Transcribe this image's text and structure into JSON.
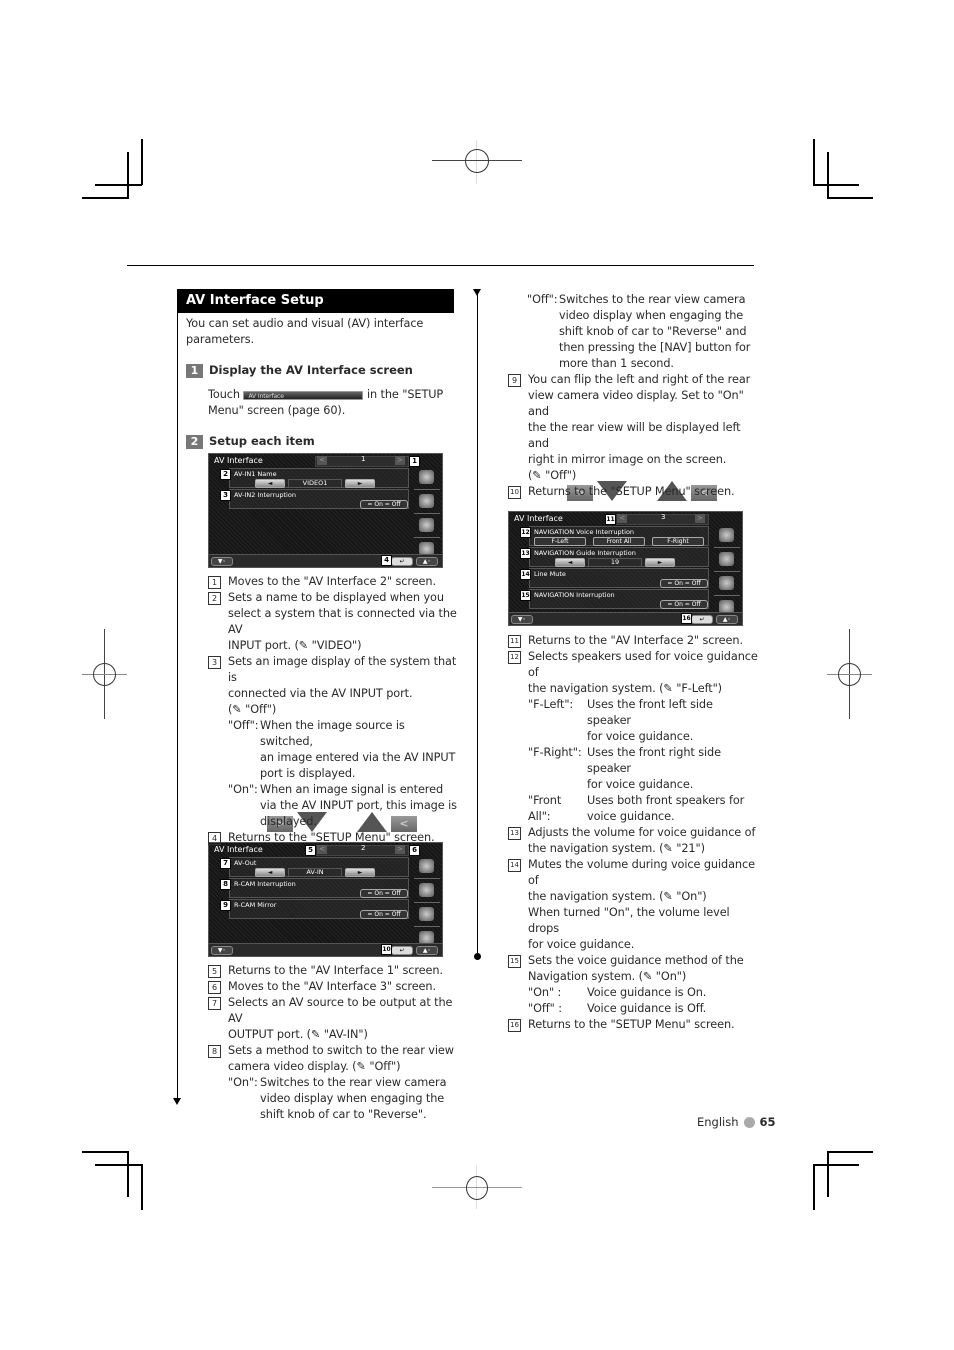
{
  "section": {
    "title": "AV Interface Setup",
    "intro": "You can set audio and visual (AV) interface parameters.",
    "intro_lines": [
      "You can set audio and visual (AV) interface",
      "parameters."
    ]
  },
  "steps": [
    {
      "num": "1",
      "label": "Display the AV Interface screen"
    },
    {
      "num": "2",
      "label": "Setup each item"
    }
  ],
  "step1_text": {
    "touch": "Touch",
    "button_label": "AV Interface",
    "rest_line1": "in the \"SETUP",
    "rest_line2": "Menu\" screen (page 60)."
  },
  "icons": {
    "wrench": "✎",
    "next": ">",
    "prev": "<",
    "return": "↵"
  },
  "screens": [
    {
      "title": "AV Interface",
      "page": "1",
      "prev_arrow": "<",
      "next_arrow": ">",
      "items": [
        {
          "badge": "2",
          "label": "AV-IN1 Name",
          "type": "selector",
          "value": "VIDEO1",
          "left": "◄",
          "right": "►"
        },
        {
          "badge": "3",
          "label": "AV-IN2 Interruption",
          "type": "onoff",
          "on": "On",
          "off": "Off"
        }
      ],
      "badges": {
        "next": "1",
        "return": "4"
      }
    },
    {
      "title": "AV Interface",
      "page": "2",
      "prev_arrow": "<",
      "next_arrow": ">",
      "items": [
        {
          "badge": "7",
          "label": "AV-Out",
          "type": "selector",
          "value": "AV-IN",
          "left": "◄",
          "right": "►"
        },
        {
          "badge": "8",
          "label": "R-CAM Interruption",
          "type": "onoff",
          "on": "On",
          "off": "Off"
        },
        {
          "badge": "9",
          "label": "R-CAM Mirror",
          "type": "onoff",
          "on": "On",
          "off": "Off"
        }
      ],
      "badges": {
        "prev": "5",
        "next": "6",
        "return": "10"
      }
    },
    {
      "title": "AV Interface",
      "page": "3",
      "prev_arrow": "<",
      "next_arrow": ">",
      "items": [
        {
          "badge": "12",
          "label": "NAVIGATION Voice Interruption",
          "type": "triple",
          "options": [
            "F-Left",
            "Front All",
            "F-Right"
          ]
        },
        {
          "badge": "13",
          "label": "NAVIGATION Guide Interruption",
          "type": "selector",
          "value": "19",
          "left": "◄",
          "right": "►"
        },
        {
          "badge": "14",
          "label": "Line Mute",
          "type": "onoff",
          "on": "On",
          "off": "Off"
        },
        {
          "badge": "15",
          "label": "NAVIGATION Interruption",
          "type": "onoff",
          "on": "On",
          "off": "Off"
        }
      ],
      "badges": {
        "prev": "11",
        "return": "16"
      }
    }
  ],
  "left_items": [
    {
      "num": "1",
      "lines": [
        "Moves to the \"AV Interface 2\" screen."
      ]
    },
    {
      "num": "2",
      "lines": [
        "Sets a name to be displayed when you",
        "select a system that is connected via the AV",
        "INPUT port. (✎ \"VIDEO\")"
      ]
    },
    {
      "num": "3",
      "lines": [
        "Sets an image display of the system that is",
        "connected via the AV INPUT port.",
        "(✎ \"Off\")"
      ],
      "options": [
        {
          "label": "\"Off\":",
          "lines": [
            "When the image source is switched,",
            "an image entered via the AV INPUT",
            "port is displayed."
          ]
        },
        {
          "label": "\"On\":",
          "lines": [
            "When an image signal is entered",
            "via the AV INPUT port, this image is",
            "displayed."
          ]
        }
      ]
    },
    {
      "num": "4",
      "lines": [
        "Returns to the \"SETUP Menu\" screen."
      ]
    }
  ],
  "left_items2": [
    {
      "num": "5",
      "lines": [
        "Returns to the \"AV Interface 1\" screen."
      ]
    },
    {
      "num": "6",
      "lines": [
        "Moves to the \"AV Interface 3\" screen."
      ]
    },
    {
      "num": "7",
      "lines": [
        "Selects an AV source to be output at the AV",
        "OUTPUT port. (✎ \"AV-IN\")"
      ]
    },
    {
      "num": "8",
      "lines": [
        "Sets a method to switch to the rear view",
        "camera video display. (✎ \"Off\")"
      ],
      "options": [
        {
          "label": "\"On\":",
          "lines": [
            "Switches to the rear view camera",
            "video display when engaging the",
            "shift knob of car to \"Reverse\"."
          ]
        }
      ]
    }
  ],
  "right_cont": {
    "label": "\"Off\":",
    "lines": [
      "Switches to the rear view camera",
      "video display when engaging the",
      "shift knob of car to \"Reverse\" and",
      "then pressing the [NAV] button for",
      "more than 1 second."
    ]
  },
  "right_items": [
    {
      "num": "9",
      "lines": [
        "You can flip the left and right of the rear",
        "view camera video display. Set to \"On\" and",
        "the the rear view will be displayed left and",
        "right in mirror image on the screen.",
        "(✎ \"Off\")"
      ]
    },
    {
      "num": "10",
      "lines": [
        "Returns to the \"SETUP Menu\" screen."
      ]
    }
  ],
  "right_items2": [
    {
      "num": "11",
      "lines": [
        "Returns to the \"AV Interface 2\" screen."
      ]
    },
    {
      "num": "12",
      "lines": [
        "Selects speakers used for voice guidance of",
        "the navigation system. (✎ \"F-Left\")"
      ],
      "options": [
        {
          "label": "\"F-Left\":",
          "lines": [
            "Uses the front left side speaker",
            "for voice guidance."
          ]
        },
        {
          "label": "\"F-Right\":",
          "lines": [
            "Uses the front right side speaker",
            "for voice guidance."
          ]
        },
        {
          "label": "\"Front All\":",
          "lines": [
            "Uses both front speakers for",
            "voice guidance."
          ]
        }
      ]
    },
    {
      "num": "13",
      "lines": [
        "Adjusts the volume for voice guidance of",
        "the navigation system. (✎ \"21\")"
      ]
    },
    {
      "num": "14",
      "lines": [
        "Mutes the volume during voice guidance of",
        "the navigation system. (✎ \"On\")",
        "When turned \"On\", the volume level drops",
        "for voice guidance."
      ]
    },
    {
      "num": "15",
      "lines": [
        "Sets the voice guidance method of the",
        "Navigation system. (✎ \"On\")"
      ],
      "options": [
        {
          "label": "\"On\" :",
          "lines": [
            "Voice guidance is On."
          ]
        },
        {
          "label": "\"Off\" :",
          "lines": [
            "Voice guidance is Off."
          ]
        }
      ]
    },
    {
      "num": "16",
      "lines": [
        "Returns to the \"SETUP Menu\" screen."
      ]
    }
  ],
  "footer": {
    "language": "English",
    "page": "65"
  }
}
